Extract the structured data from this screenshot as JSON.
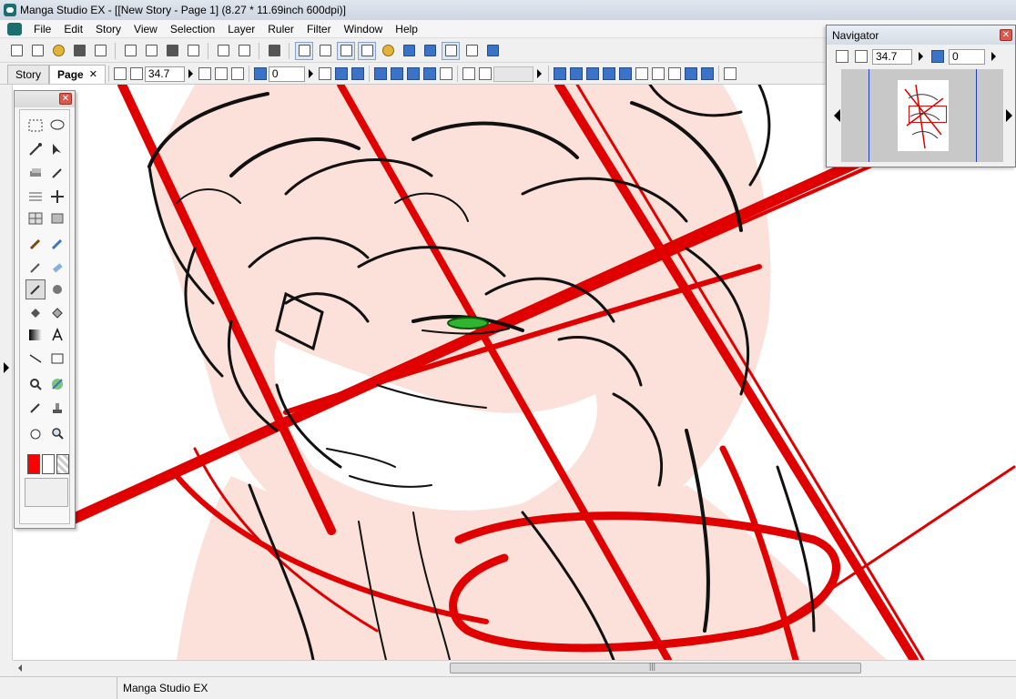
{
  "window": {
    "title": "Manga Studio EX - [[New Story - Page 1] (8.27 * 11.69inch 600dpi)]"
  },
  "menu": {
    "items": [
      "File",
      "Edit",
      "Story",
      "View",
      "Selection",
      "Layer",
      "Ruler",
      "Filter",
      "Window",
      "Help"
    ]
  },
  "tabs": {
    "story": "Story",
    "page": "Page",
    "close": "✕"
  },
  "toolbar2": {
    "zoom_value": "34.7",
    "rotation_value": "0"
  },
  "palette": {
    "close": "✕"
  },
  "navigator": {
    "title": "Navigator",
    "close": "✕",
    "zoom_value": "34.7",
    "rotation_value": "0"
  },
  "status": {
    "text": "Manga Studio EX"
  },
  "colors": {
    "foreground": "#ff0000",
    "background": "#ffffff",
    "accent": "#3a73c8",
    "line": "#e00000"
  },
  "icons": {
    "toolbar1": [
      "new-page-icon",
      "new-story-icon",
      "open-icon",
      "save-icon",
      "save-all-icon",
      "cut-icon",
      "copy-icon",
      "paste-icon",
      "delete-icon",
      "undo-icon",
      "redo-icon",
      "print-icon",
      "view-mode-icon",
      "view-mode-icon",
      "view-mode-icon",
      "view-mode-icon",
      "layer-icon",
      "properties-icon",
      "palette-icon",
      "grid-icon",
      "tool-options-icon",
      "play-icon"
    ],
    "tools": [
      "marquee-icon",
      "lasso-icon",
      "magic-wand-icon",
      "object-select-icon",
      "layer-move-icon",
      "eyedropper-icon",
      "tone-icon",
      "move-icon",
      "panel-icon",
      "frame-icon",
      "pen-icon",
      "marker-icon",
      "pencil-icon",
      "eraser-icon",
      "brush-icon",
      "airbrush-icon",
      "fill-icon",
      "pattern-fill-icon",
      "gradient-icon",
      "text-icon",
      "line-icon",
      "rectangle-icon",
      "selection-pen-icon",
      "tone-eraser-icon",
      "correct-line-icon",
      "stamp-icon",
      "hand-icon",
      "zoom-icon"
    ]
  }
}
